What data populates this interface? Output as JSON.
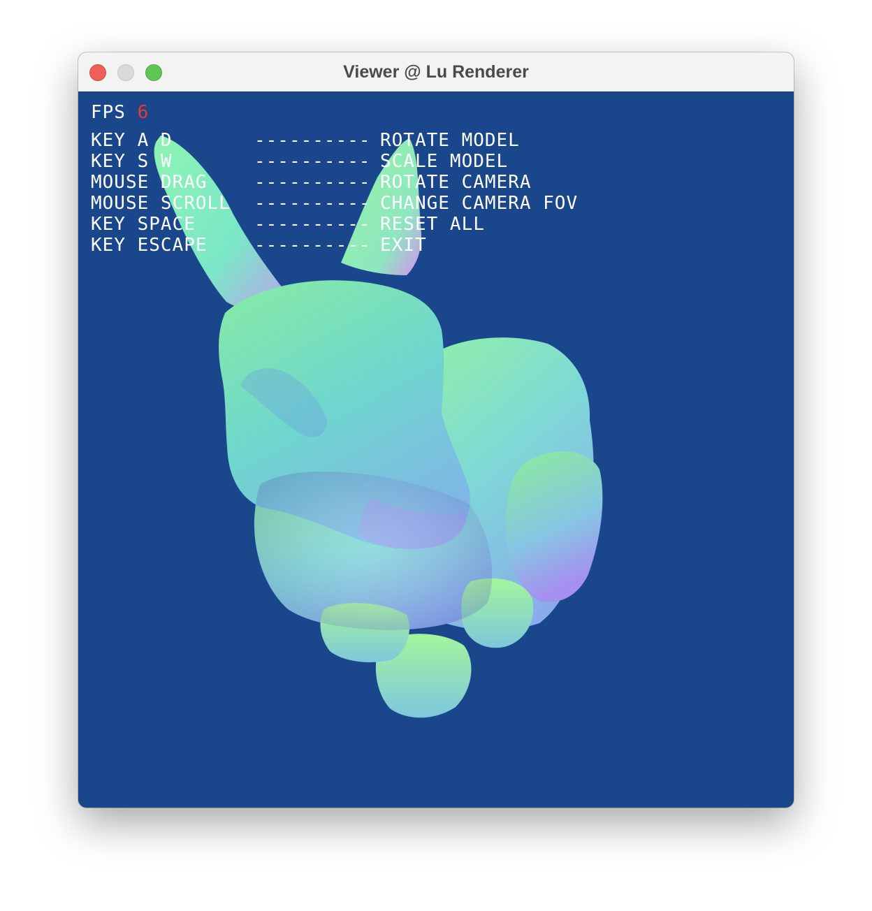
{
  "window": {
    "title": "Viewer @ Lu Renderer",
    "background_color": "#1a468b"
  },
  "hud": {
    "fps_label": "FPS",
    "fps_value": "6",
    "fps_value_color": "#e53b30",
    "text_color": "#ffffff",
    "help": [
      {
        "key": "KEY A D",
        "separator": "----------",
        "action": "ROTATE MODEL"
      },
      {
        "key": "KEY S W",
        "separator": "----------",
        "action": "SCALE MODEL"
      },
      {
        "key": "MOUSE DRAG",
        "separator": "----------",
        "action": "ROTATE CAMERA"
      },
      {
        "key": "MOUSE SCROLL",
        "separator": "----------",
        "action": "CHANGE CAMERA FOV"
      },
      {
        "key": "KEY SPACE",
        "separator": "----------",
        "action": "RESET ALL"
      },
      {
        "key": "KEY ESCAPE",
        "separator": "----------",
        "action": "EXIT"
      }
    ]
  }
}
